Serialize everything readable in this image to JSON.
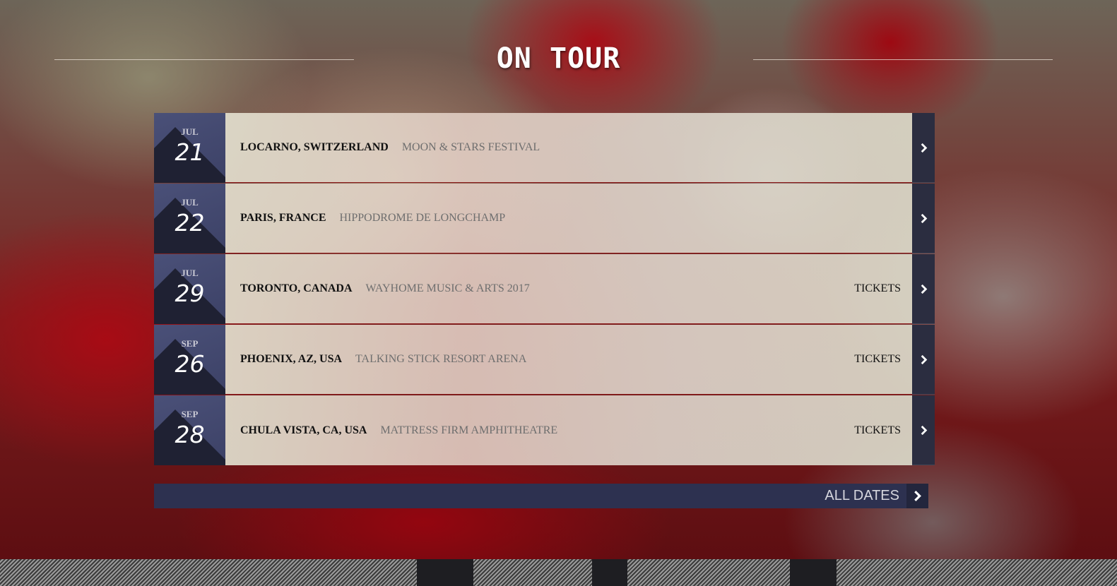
{
  "section": {
    "title": "ON TOUR"
  },
  "tour_dates": [
    {
      "month": "JUL",
      "day": "21",
      "city": "LOCARNO, SWITZERLAND",
      "venue": "MOON & STARS FESTIVAL",
      "tickets": ""
    },
    {
      "month": "JUL",
      "day": "22",
      "city": "PARIS, FRANCE",
      "venue": "HIPPODROME DE LONGCHAMP",
      "tickets": ""
    },
    {
      "month": "JUL",
      "day": "29",
      "city": "TORONTO, CANADA",
      "venue": "WAYHOME MUSIC & ARTS 2017",
      "tickets": "TICKETS"
    },
    {
      "month": "SEP",
      "day": "26",
      "city": "PHOENIX, AZ, USA",
      "venue": "TALKING STICK RESORT ARENA",
      "tickets": "TICKETS"
    },
    {
      "month": "SEP",
      "day": "28",
      "city": "CHULA VISTA, CA, USA",
      "venue": "MATTRESS FIRM AMPHITHEATRE",
      "tickets": "TICKETS"
    }
  ],
  "footer": {
    "all_dates_label": "ALL DATES"
  },
  "icons": {
    "row_arrow": "chevron-right-icon",
    "all_dates_arrow": "chevron-right-icon"
  },
  "colors": {
    "date_box": "#3c4166",
    "arrow_box": "#2b2d40",
    "all_dates_bar": "#2d3150",
    "row_divider": "#8a1a1a"
  }
}
